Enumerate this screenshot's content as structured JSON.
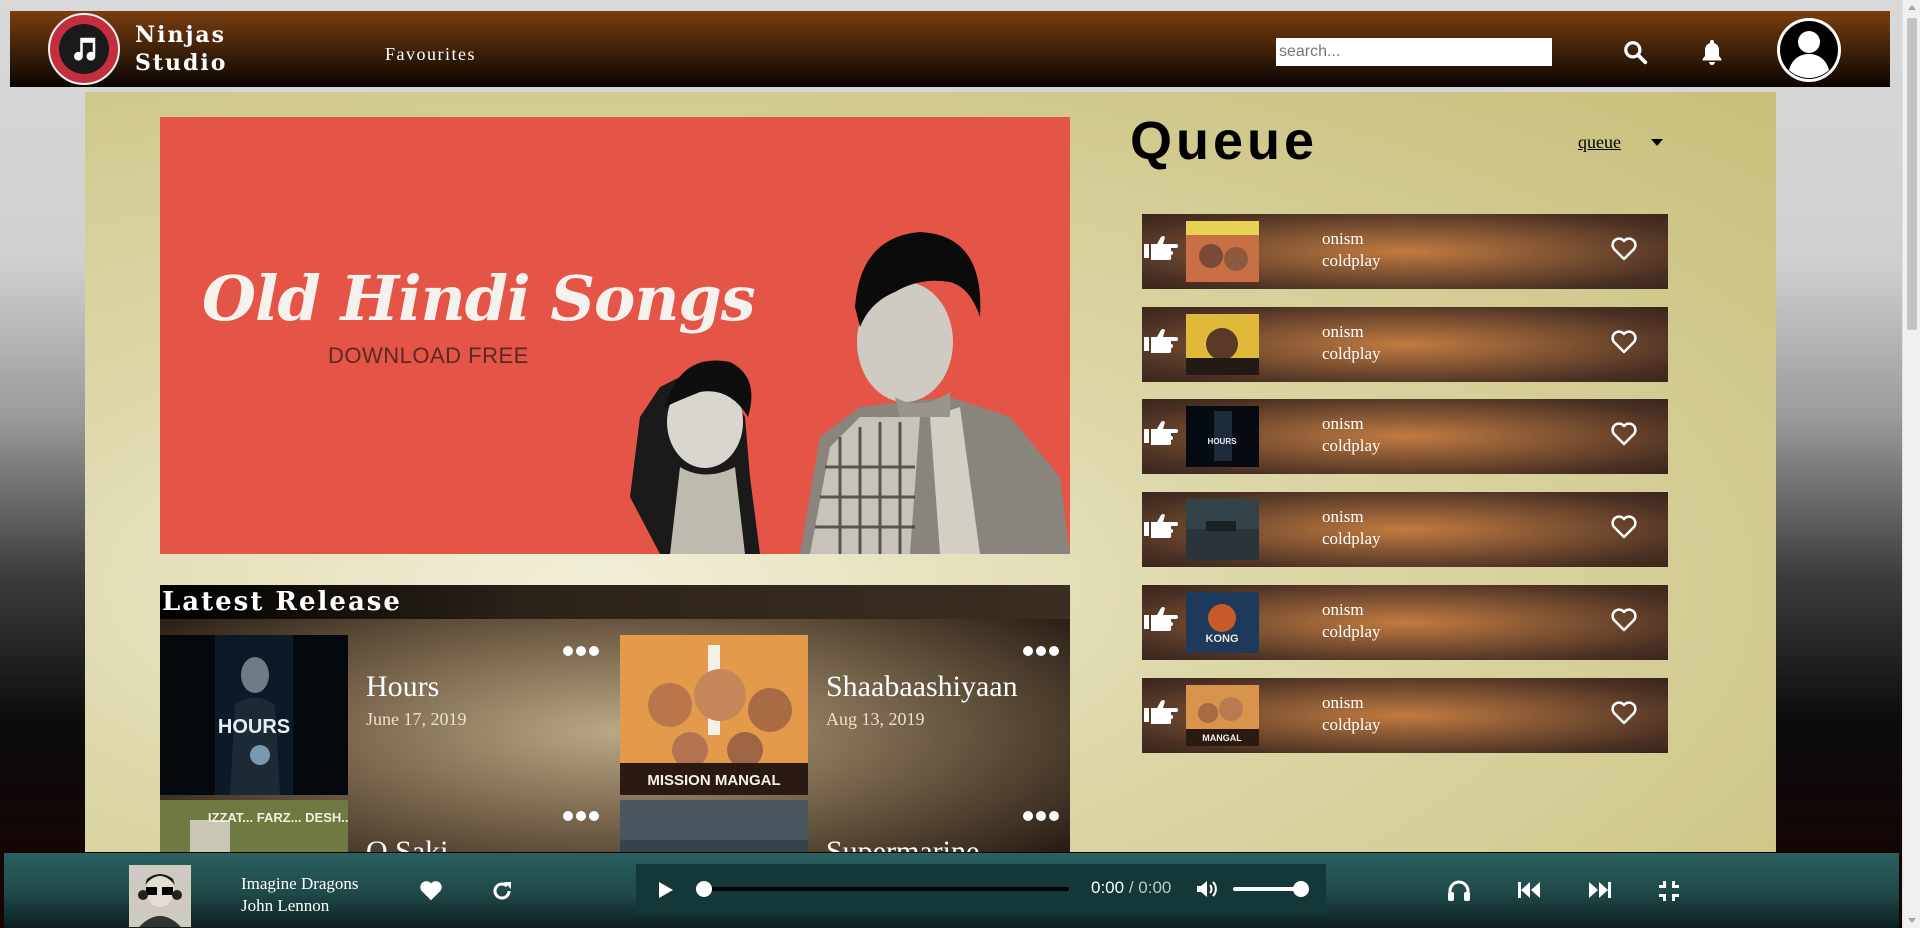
{
  "header": {
    "brand_line1": "Ninjas",
    "brand_line2": "Studio",
    "nav_favourites": "Favourites",
    "search_placeholder": "search..."
  },
  "banner": {
    "title": "Old Hindi Songs",
    "subtitle": "DOWNLOAD FREE"
  },
  "latest": {
    "heading": "Latest Release",
    "items": [
      {
        "name": "Hours",
        "date": "June 17, 2019",
        "thumb_text": "HOURS"
      },
      {
        "name": "Shaabaashiyaan",
        "date": "Aug 13, 2019",
        "thumb_text": "MISSION MANGAL"
      },
      {
        "name": "O Saki",
        "date": "",
        "thumb_text": "IZZAT... FARZ... DESH..."
      },
      {
        "name": "Supermarine",
        "date": "",
        "thumb_text": ""
      }
    ]
  },
  "queue": {
    "title": "Queue",
    "select_value": "queue",
    "items": [
      {
        "title": "onism",
        "artist": "coldplay"
      },
      {
        "title": "onism",
        "artist": "coldplay"
      },
      {
        "title": "onism",
        "artist": "coldplay",
        "thumb_text": "HOURS"
      },
      {
        "title": "onism",
        "artist": "coldplay"
      },
      {
        "title": "onism",
        "artist": "coldplay",
        "thumb_text": "KONG"
      },
      {
        "title": "onism",
        "artist": "coldplay",
        "thumb_text": "MANGAL"
      }
    ]
  },
  "player": {
    "artist_line1": "Imagine Dragons",
    "artist_line2": "John Lennon",
    "current_time": "0:00",
    "separator": " / ",
    "duration": "0:00",
    "progress": 0,
    "volume": 0.85
  },
  "colors": {
    "brand_red": "#c42f3f",
    "banner_red": "#e45447",
    "player_teal": "#2b6060"
  },
  "icons": [
    "music-note-icon",
    "search-icon",
    "bell-icon",
    "user-avatar-icon",
    "pointing-hand-icon",
    "heart-outline-icon",
    "heart-filled-icon",
    "repeat-icon",
    "play-icon",
    "volume-icon",
    "headphones-icon",
    "skip-back-icon",
    "skip-forward-icon",
    "minimize-icon",
    "more-dots-icon"
  ]
}
